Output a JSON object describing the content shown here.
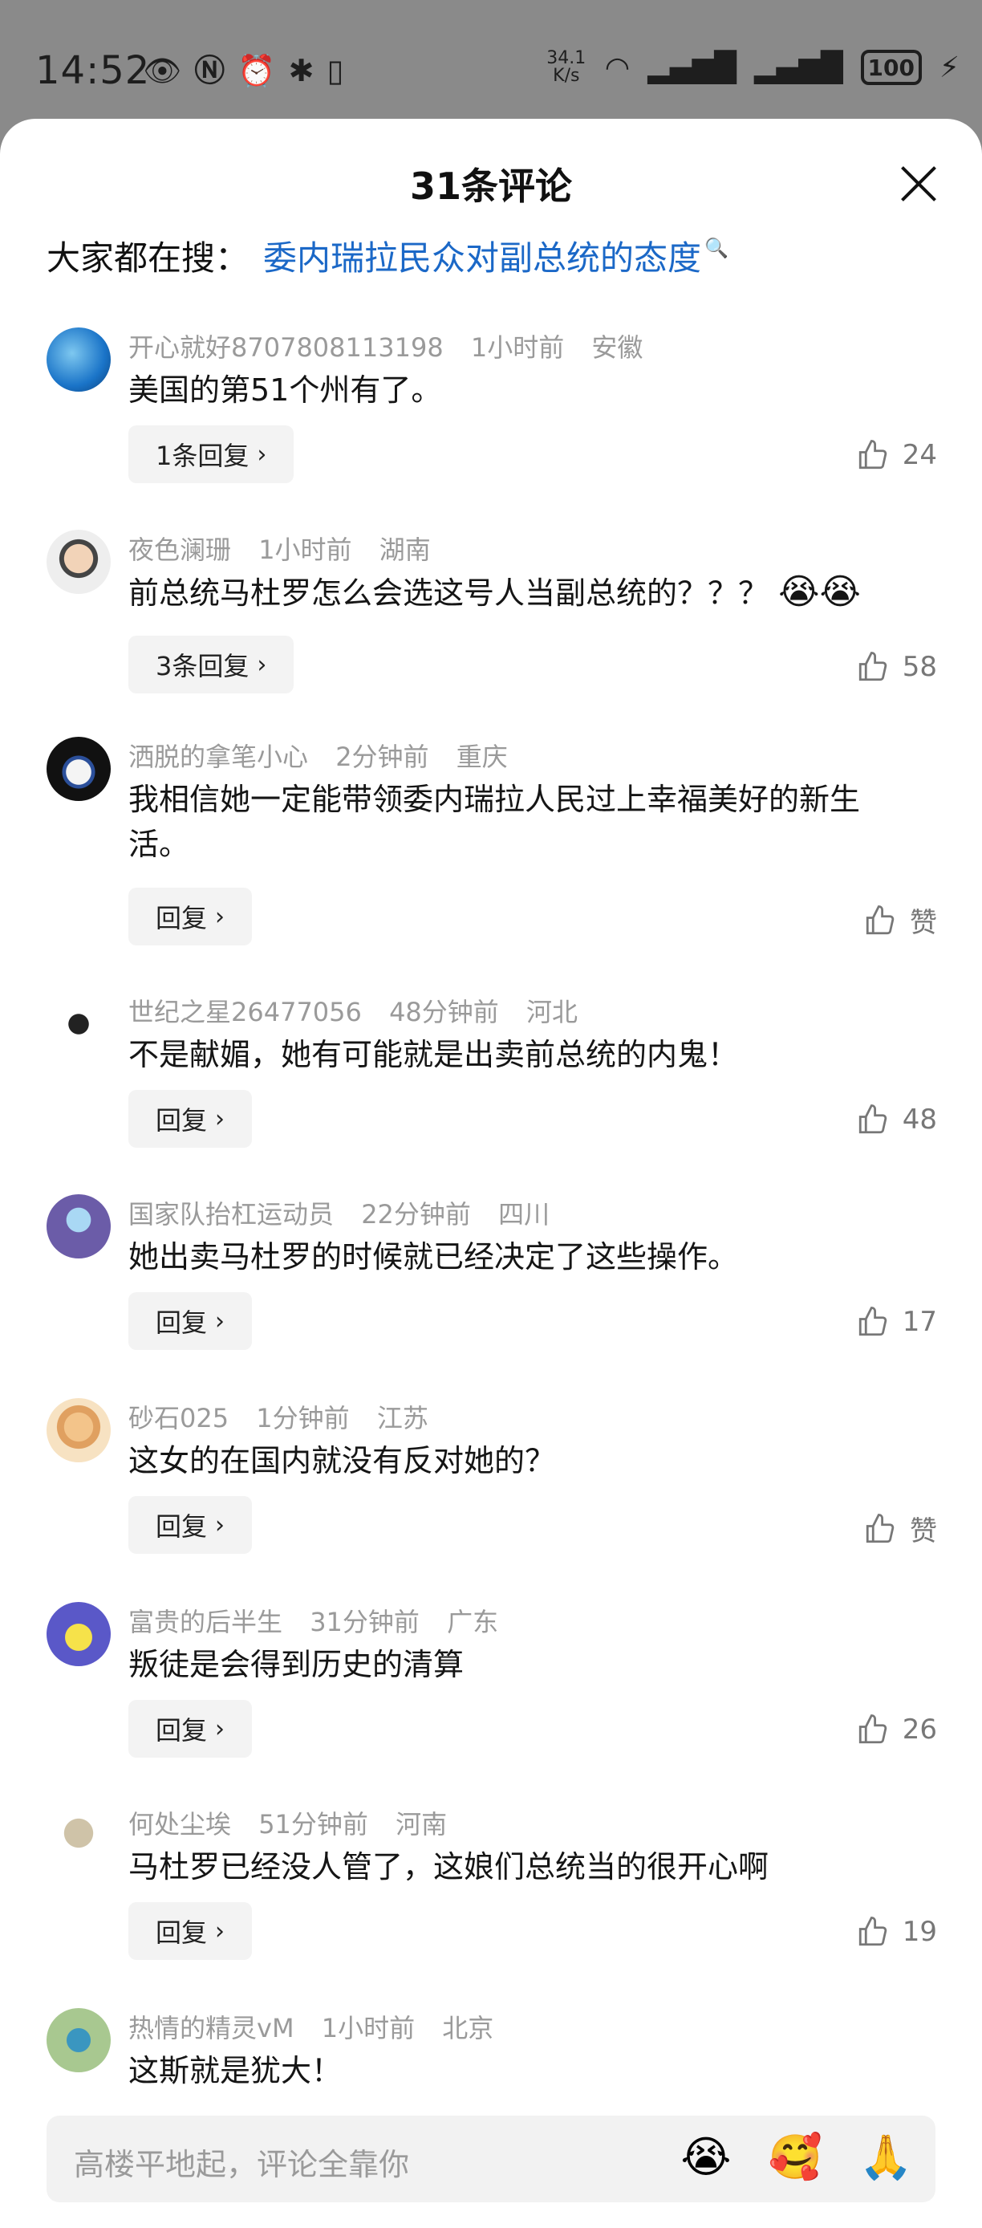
{
  "status_bar": {
    "time": "14:52",
    "speed": "34.1\nK/s",
    "battery": "100",
    "icons": [
      "eye-icon",
      "nfc-icon",
      "alarm-icon",
      "bluetooth-icon",
      "vibrate-icon",
      "wifi-icon",
      "signal-icon",
      "signal-icon",
      "charging-icon"
    ]
  },
  "sheet": {
    "title": "31条评论",
    "hot_search_label": "大家都在搜：",
    "hot_search_link": "委内瑞拉民众对副总统的态度"
  },
  "comments": [
    {
      "user": "开心就好8707808113198",
      "time": "1小时前",
      "loc": "安徽",
      "text": "美国的第51个州有了。",
      "reply": "1条回复",
      "likes": "24"
    },
    {
      "user": "夜色澜珊",
      "time": "1小时前",
      "loc": "湖南",
      "text": "前总统马杜罗怎么会选这号人当副总统的？？？",
      "emoji": "😭😭",
      "reply": "3条回复",
      "likes": "58"
    },
    {
      "user": "洒脱的拿笔小心",
      "time": "2分钟前",
      "loc": "重庆",
      "text": "我相信她一定能带领委内瑞拉人民过上幸福美好的新生活。",
      "reply": "回复",
      "likes": "赞"
    },
    {
      "user": "世纪之星26477056",
      "time": "48分钟前",
      "loc": "河北",
      "text": "不是献媚，她有可能就是出卖前总统的内鬼！",
      "reply": "回复",
      "likes": "48"
    },
    {
      "user": "国家队抬杠运动员",
      "time": "22分钟前",
      "loc": "四川",
      "text": "她出卖马杜罗的时候就已经决定了这些操作。",
      "reply": "回复",
      "likes": "17"
    },
    {
      "user": "砂石025",
      "time": "1分钟前",
      "loc": "江苏",
      "text": "这女的在国内就没有反对她的？",
      "reply": "回复",
      "likes": "赞"
    },
    {
      "user": "富贵的后半生",
      "time": "31分钟前",
      "loc": "广东",
      "text": "叛徒是会得到历史的清算",
      "reply": "回复",
      "likes": "26"
    },
    {
      "user": "何处尘埃",
      "time": "51分钟前",
      "loc": "河南",
      "text": "马杜罗已经没人管了，这娘们总统当的很开心啊",
      "reply": "回复",
      "likes": "19"
    },
    {
      "user": "热情的精灵vM",
      "time": "1小时前",
      "loc": "北京",
      "text": "这斯就是犹大！"
    }
  ],
  "input": {
    "placeholder": "高楼平地起，评论全靠你",
    "emojis": [
      "😭",
      "🥰",
      "🙏"
    ]
  },
  "colors": {
    "accent": "#1b68c7",
    "sheet_bg": "#ffffff",
    "overlay": "#8a8a8a"
  }
}
